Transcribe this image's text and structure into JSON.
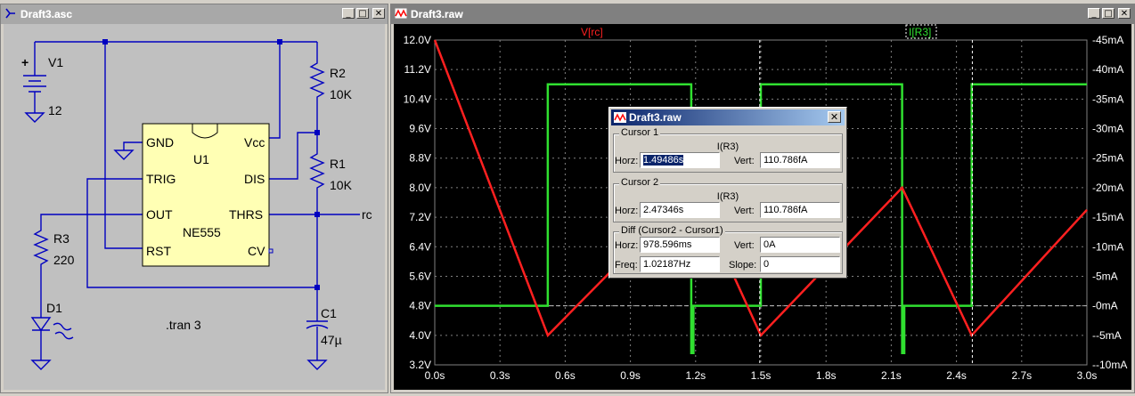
{
  "schematic_window": {
    "title": "Draft3.asc",
    "components": {
      "v1_name": "V1",
      "v1_value": "12",
      "r2_name": "R2",
      "r2_value": "10K",
      "r1_name": "R1",
      "r1_value": "10K",
      "r3_name": "R3",
      "r3_value": "220",
      "c1_name": "C1",
      "c1_value": "47µ",
      "d1_name": "D1",
      "u1_name": "U1",
      "u1_part": "NE555",
      "pins": [
        "GND",
        "TRIG",
        "OUT",
        "RST",
        "Vcc",
        "DIS",
        "THRS",
        "CV"
      ],
      "net_label": "rc",
      "directive": ".tran 3"
    }
  },
  "plot_window": {
    "title": "Draft3.raw",
    "trace_labels": {
      "vrc": "V[rc]",
      "ir3": "I[R3]"
    },
    "colors": {
      "vrc": "#ff2020",
      "ir3": "#30e030",
      "grid": "#808080",
      "axis_text": "#ffffff"
    }
  },
  "chart_data": {
    "type": "line",
    "x": [
      0.0,
      0.53,
      0.53,
      1.2,
      1.2,
      1.5,
      1.5,
      2.16,
      2.16,
      2.47,
      2.47,
      3.0
    ],
    "xlim": [
      0,
      3.0
    ],
    "xticks": [
      "0.0s",
      "0.3s",
      "0.6s",
      "0.9s",
      "1.2s",
      "1.5s",
      "1.8s",
      "2.1s",
      "2.4s",
      "2.7s",
      "3.0s"
    ],
    "ylim_left": [
      3.2,
      12.0
    ],
    "yticks_left": [
      "12.0V",
      "11.2V",
      "10.4V",
      "9.6V",
      "8.8V",
      "8.0V",
      "7.2V",
      "6.4V",
      "5.6V",
      "4.8V",
      "4.0V",
      "3.2V"
    ],
    "ylim_right": [
      -10,
      45
    ],
    "yticks_right": [
      "45mA",
      "40mA",
      "35mA",
      "30mA",
      "25mA",
      "20mA",
      "15mA",
      "10mA",
      "5mA",
      "0mA",
      "-5mA",
      "-10mA"
    ],
    "series": [
      {
        "name": "V[rc]",
        "x": [
          0.0,
          0.52,
          1.19,
          1.5,
          2.15,
          2.47,
          3.0
        ],
        "y": [
          12.0,
          4.0,
          8.0,
          4.0,
          8.0,
          4.0,
          7.4
        ]
      },
      {
        "name": "I[R3]",
        "x": [
          0.0,
          0.52,
          0.52,
          1.18,
          1.18,
          1.19,
          1.19,
          1.5,
          1.5,
          2.15,
          2.15,
          2.16,
          2.16,
          2.47,
          2.47,
          3.0
        ],
        "y": [
          0.0,
          0.0,
          37.5,
          37.5,
          -8.0,
          -8.0,
          0.0,
          0.0,
          37.5,
          37.5,
          -8.0,
          -8.0,
          0.0,
          0.0,
          37.5,
          37.5
        ]
      }
    ]
  },
  "cursor_dialog": {
    "title": "Draft3.raw",
    "cursor1": {
      "label": "Cursor 1",
      "signal": "I(R3)",
      "horz_label": "Horz:",
      "horz": "1.49486s",
      "vert_label": "Vert:",
      "vert": "110.786fA"
    },
    "cursor2": {
      "label": "Cursor 2",
      "signal": "I(R3)",
      "horz_label": "Horz:",
      "horz": "2.47346s",
      "vert_label": "Vert:",
      "vert": "110.786fA"
    },
    "diff": {
      "label": "Diff (Cursor2 - Cursor1)",
      "horz_label": "Horz:",
      "horz": "978.596ms",
      "vert_label": "Vert:",
      "vert": "0A",
      "freq_label": "Freq:",
      "freq": "1.02187Hz",
      "slope_label": "Slope:",
      "slope": "0"
    }
  }
}
